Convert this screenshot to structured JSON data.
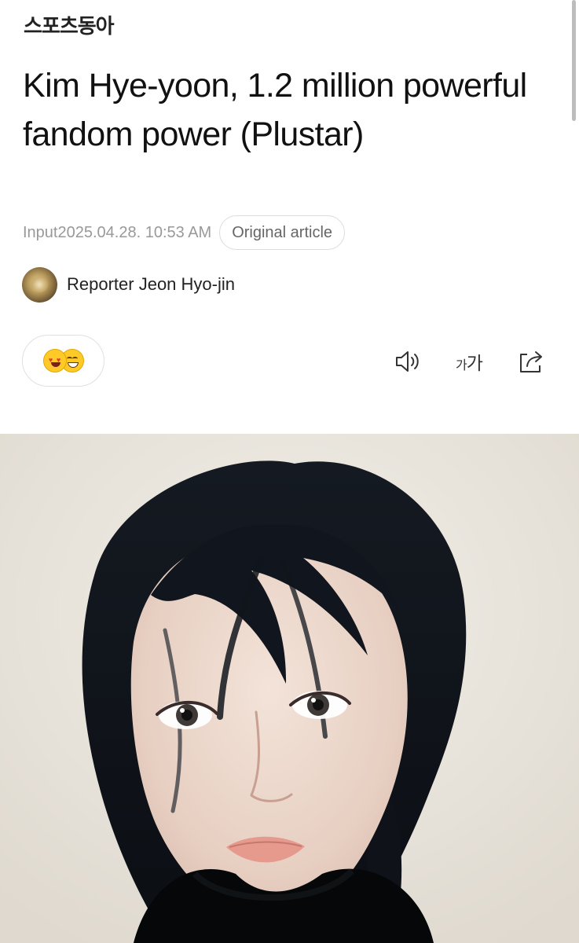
{
  "publication": {
    "logo_text": "스포츠동아"
  },
  "article": {
    "headline": "Kim Hye-yoon, 1.2 million powerful fandom power (Plustar)",
    "input_label": "Input",
    "published": "2025.04.28. 10:53 AM",
    "original_article_label": "Original article",
    "reporter": "Reporter Jeon Hyo-jin"
  },
  "reactions": {
    "emojis": [
      "heart-eyes-emoji",
      "laughing-emoji"
    ]
  },
  "toolbar": {
    "font_size_small": "가",
    "font_size_large": "가",
    "icons": [
      "speaker-icon",
      "font-size-icon",
      "share-icon"
    ]
  },
  "colors": {
    "text_primary": "#111111",
    "text_secondary": "#999999",
    "border": "#dcdcdc",
    "photo_background": "#ebe7df"
  }
}
